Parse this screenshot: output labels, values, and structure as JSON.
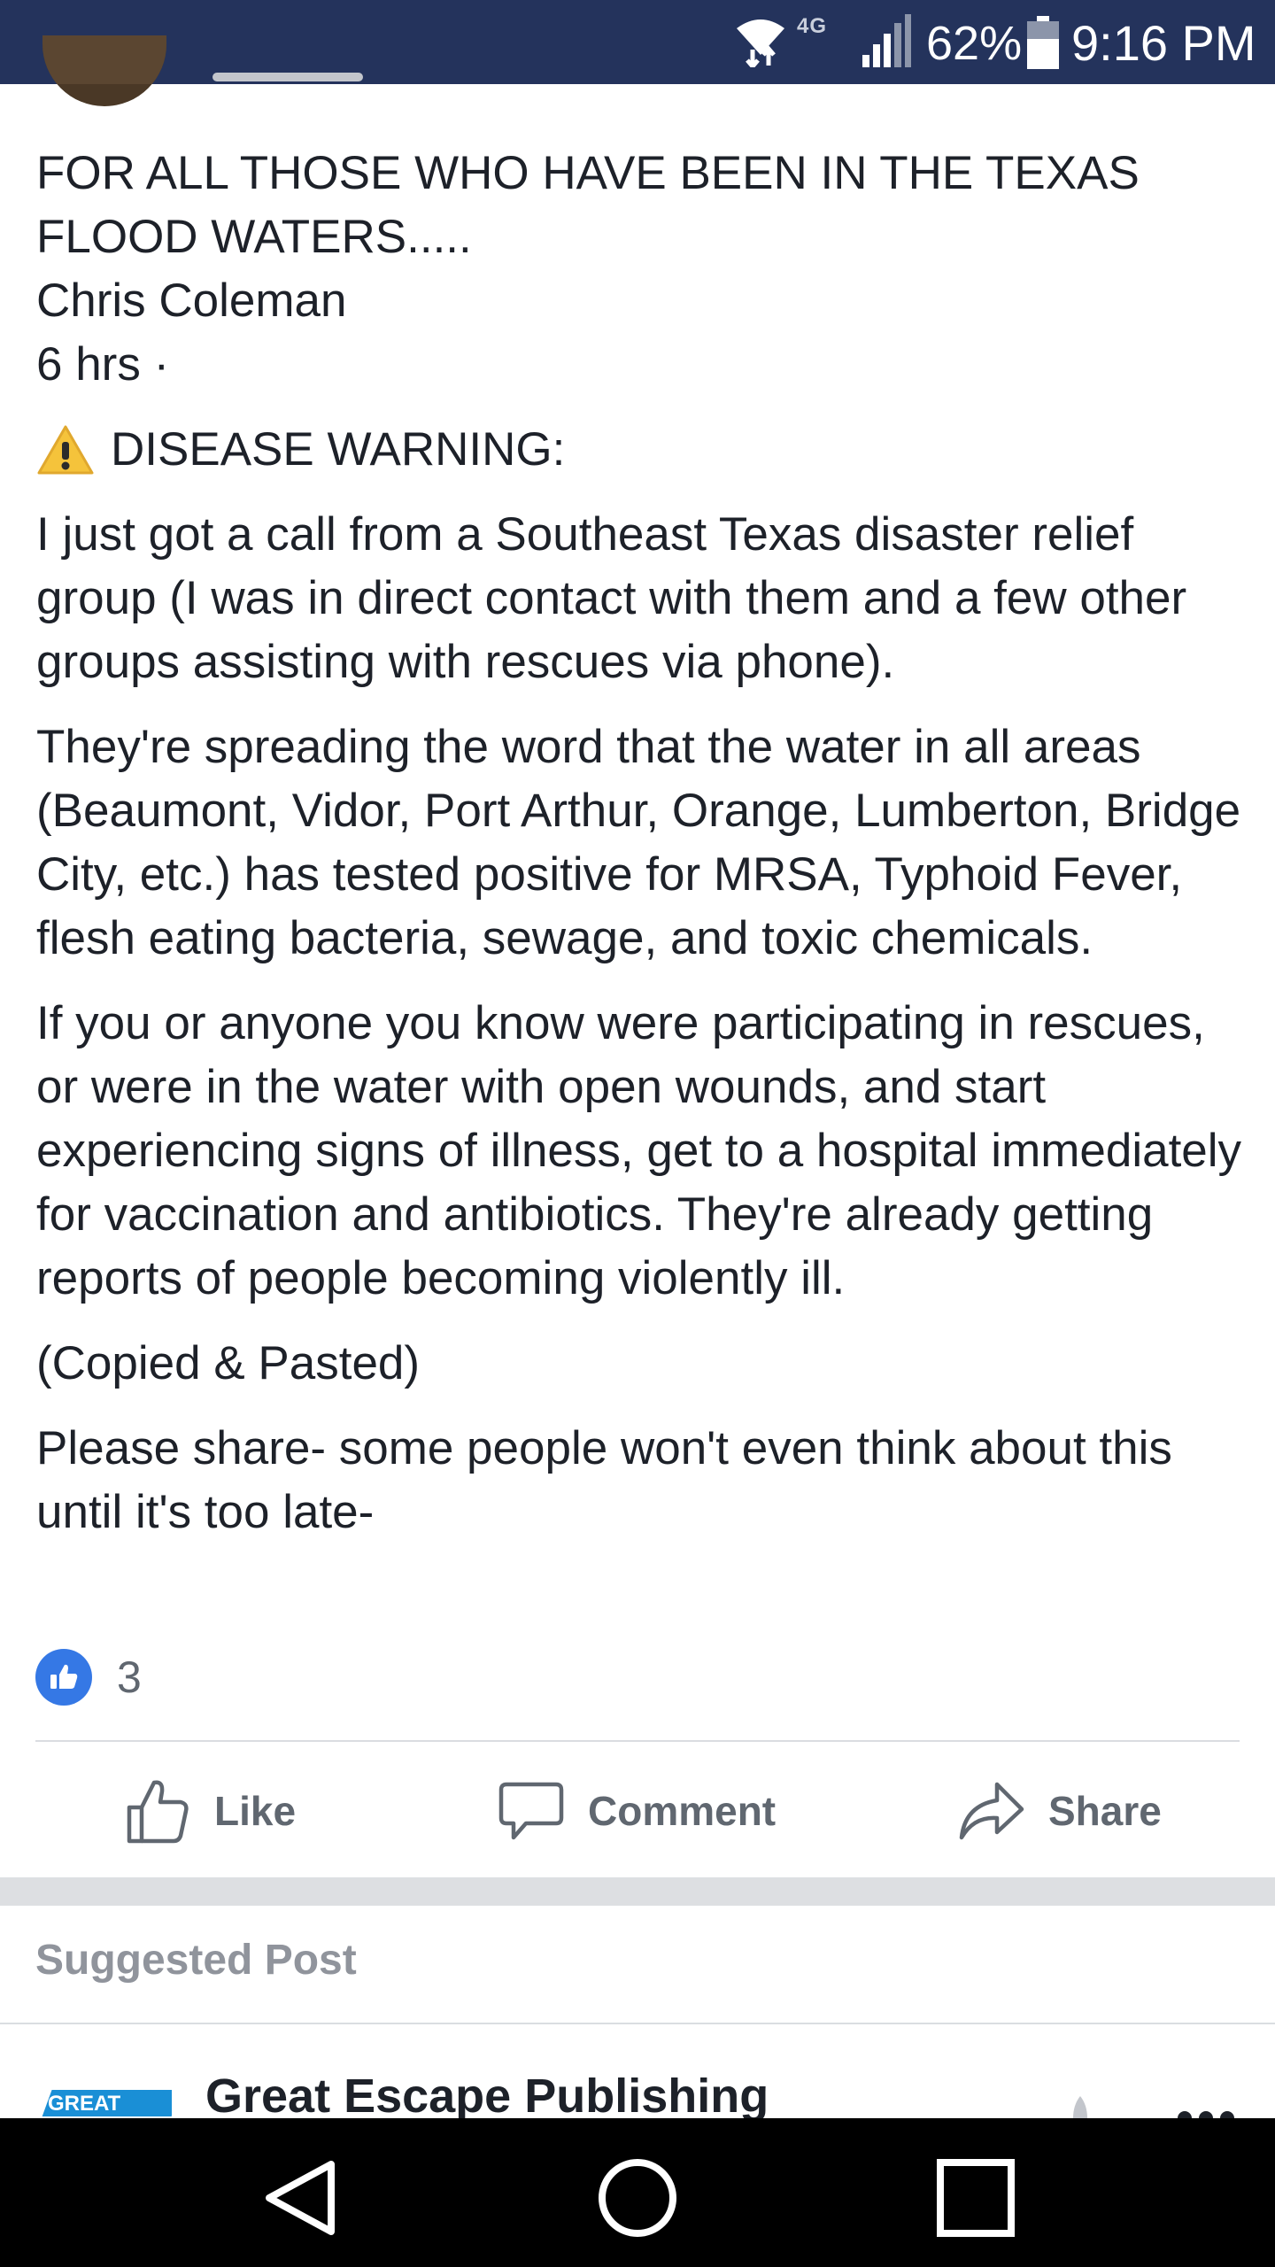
{
  "status_bar": {
    "network": "4G",
    "battery_percent": "62%",
    "time": "9:16 PM",
    "background": "#24335c"
  },
  "post": {
    "lines": [
      "FOR ALL THOSE WHO HAVE BEEN IN THE TEXAS",
      "FLOOD WATERS.....",
      "Chris Coleman",
      "6 hrs ·"
    ],
    "warning_label": "DISEASE WARNING:",
    "paragraphs": [
      "I just got a call from a Southeast Texas disaster relief group (I was in direct contact with them and a few other groups assisting with rescues via phone).",
      "They're spreading the word that the water in all areas (Beaumont, Vidor, Port Arthur, Orange, Lumberton, Bridge City, etc.) has tested positive for MRSA, Typhoid Fever, flesh eating bacteria, sewage, and toxic chemicals.",
      "If you or anyone you know were participating in rescues, or were in the water with open wounds, and start experiencing signs of illness, get to a hospital immediately for vaccination and antibiotics. They're already getting reports of people becoming violently ill.",
      "(Copied & Pasted)",
      "Please share- some people won't even think about this until it's too late-"
    ],
    "icons": {
      "warning": "warning-icon",
      "reaction": "like-reaction-icon"
    },
    "reaction_count": "3"
  },
  "actions": {
    "like": "Like",
    "comment": "Comment",
    "share": "Share",
    "icons": [
      "thumbs-up-icon",
      "comment-icon",
      "share-arrow-icon"
    ]
  },
  "suggested": {
    "header": "Suggested Post",
    "page_name": "Great Escape Publishing",
    "logo_text": "GREAT"
  },
  "nav": {
    "buttons": [
      "back-icon",
      "home-icon",
      "recents-icon"
    ]
  },
  "colors": {
    "brand_blue": "#3578e5",
    "text_primary": "#1d2129",
    "text_secondary": "#606770",
    "muted": "#90949c",
    "separator": "#dddfe2"
  }
}
